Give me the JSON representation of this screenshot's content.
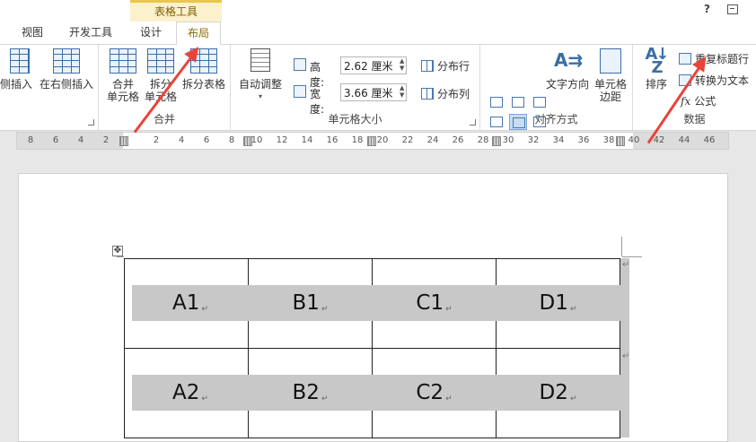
{
  "context_tab_header": "表格工具",
  "window_controls": {
    "help": "?"
  },
  "tabs": {
    "view": "视图",
    "dev": "开发工具",
    "design": "设计",
    "layout": "布局"
  },
  "rows_cols_group": {
    "insert_left": "左侧插入",
    "insert_right": "在右侧插入"
  },
  "merge_group": {
    "label": "合并",
    "merge_cells": [
      "合并",
      "单元格"
    ],
    "split_cells": [
      "拆分",
      "单元格"
    ],
    "split_table": "拆分表格"
  },
  "size_group": {
    "label": "单元格大小",
    "autofit": "自动调整",
    "height_label": "高度:",
    "height_value": "2.62 厘米",
    "width_label": "宽度:",
    "width_value": "3.66 厘米",
    "distribute_rows": "分布行",
    "distribute_cols": "分布列"
  },
  "align_group": {
    "label": "对齐方式",
    "text_direction": "文字方向",
    "cell_margins": [
      "单元格",
      "边距"
    ]
  },
  "data_group": {
    "label": "数据",
    "sort": "排序",
    "repeat_header": "重复标题行",
    "convert_to_text": "转换为文本",
    "formula": "公式",
    "formula_icon_text": "fx"
  },
  "ruler_ticks": [
    "8",
    "6",
    "4",
    "2",
    "2",
    "4",
    "6",
    "8",
    "10",
    "12",
    "14",
    "16",
    "18",
    "20",
    "22",
    "24",
    "26",
    "28",
    "30",
    "32",
    "34",
    "36",
    "38",
    "40",
    "42",
    "44",
    "46"
  ],
  "table": {
    "rows": [
      [
        "A1",
        "B1",
        "C1",
        "D1"
      ],
      [
        "A2",
        "B2",
        "C2",
        "D2"
      ]
    ],
    "paragraph_mark": "↵"
  },
  "colors": {
    "accent_tab": "#8a6a00",
    "context_bg": "#fcf1cd",
    "arrow": "#e8443a",
    "cell_shade": "#c8c8c8"
  }
}
